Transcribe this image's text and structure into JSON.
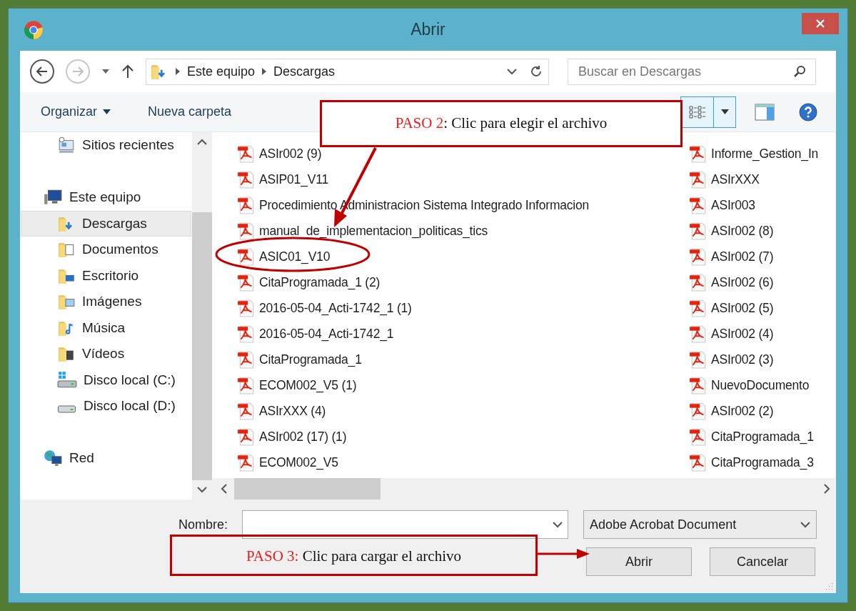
{
  "window": {
    "title": "Abrir"
  },
  "address": {
    "path": [
      "Este equipo",
      "Descargas"
    ]
  },
  "search": {
    "placeholder": "Buscar en Descargas"
  },
  "commands": [
    "Organizar",
    "Nueva carpeta"
  ],
  "sidebar": {
    "items": [
      {
        "label": "Sitios recientes",
        "kind": "recent",
        "selected": false
      },
      {
        "label": "Este equipo",
        "kind": "computer",
        "selected": false,
        "children": [
          {
            "label": "Descargas",
            "kind": "downloads",
            "selected": true
          },
          {
            "label": "Documentos",
            "kind": "documents",
            "selected": false
          },
          {
            "label": "Escritorio",
            "kind": "desktop",
            "selected": false
          },
          {
            "label": "Imágenes",
            "kind": "pictures",
            "selected": false
          },
          {
            "label": "Música",
            "kind": "music",
            "selected": false
          },
          {
            "label": "Vídeos",
            "kind": "videos",
            "selected": false
          },
          {
            "label": "Disco local (C:)",
            "kind": "system-drive",
            "selected": false
          },
          {
            "label": "Disco local (D:)",
            "kind": "drive",
            "selected": false
          }
        ]
      },
      {
        "label": "Red",
        "kind": "network",
        "selected": false
      }
    ]
  },
  "files": {
    "columns": [
      [
        {
          "name": "ASIr002 (9)",
          "selected": false
        },
        {
          "name": "ASIP01_V11",
          "selected": false
        },
        {
          "name": "Procedimiento Administracion Sistema Integrado Informacion",
          "selected": false
        },
        {
          "name": "manual_de_implementacion_politicas_tics",
          "selected": false
        },
        {
          "name": "ASIC01_V10",
          "selected": false
        },
        {
          "name": "CitaProgramada_1 (2)",
          "selected": false
        },
        {
          "name": "2016-05-04_Acti-1742_1 (1)",
          "selected": false
        },
        {
          "name": "2016-05-04_Acti-1742_1",
          "selected": false
        },
        {
          "name": "CitaProgramada_1",
          "selected": false
        },
        {
          "name": "ECOM002_V5 (1)",
          "selected": false
        },
        {
          "name": "ASIrXXX (4)",
          "selected": false
        },
        {
          "name": "ASIr002 (17) (1)",
          "selected": false
        },
        {
          "name": "ECOM002_V5",
          "selected": false
        }
      ],
      [
        {
          "name": "Informe_Gestion_In",
          "selected": false
        },
        {
          "name": "ASIrXXX",
          "selected": false
        },
        {
          "name": "ASIr003",
          "selected": false
        },
        {
          "name": "ASIr002 (8)",
          "selected": false
        },
        {
          "name": "ASIr002 (7)",
          "selected": false
        },
        {
          "name": "ASIr002 (6)",
          "selected": false
        },
        {
          "name": "ASIr002 (5)",
          "selected": false
        },
        {
          "name": "ASIr002 (4)",
          "selected": false
        },
        {
          "name": "ASIr002 (3)",
          "selected": false
        },
        {
          "name": "NuevoDocumento",
          "selected": false
        },
        {
          "name": "ASIr002 (2)",
          "selected": false
        },
        {
          "name": "CitaProgramada_1",
          "selected": false
        },
        {
          "name": "CitaProgramada_3",
          "selected": false
        }
      ]
    ]
  },
  "footer": {
    "name_label": "Nombre:",
    "file_type": "Adobe Acrobat Document",
    "buttons": [
      "Abrir",
      "Cancelar"
    ]
  },
  "annotations": [
    {
      "label": "PASO 2",
      "text": ": Clic para elegir el archivo"
    },
    {
      "label": "PASO 3:",
      "text": " Clic para cargar el archivo"
    }
  ]
}
